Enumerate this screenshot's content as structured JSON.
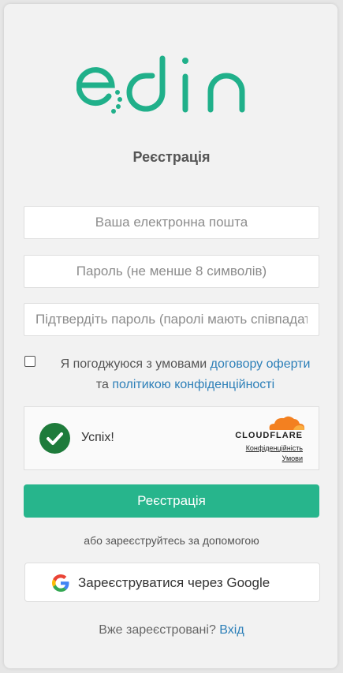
{
  "brand": {
    "logo_text": "edin",
    "logo_color": "#20b08a"
  },
  "form": {
    "title": "Реєстрація",
    "email_placeholder": "Ваша електронна пошта",
    "password_placeholder": "Пароль (не менше 8 символів)",
    "confirm_placeholder": "Підтвердіть пароль (паролі мають співпадати)",
    "agree_prefix": "Я погоджуюся з умовами",
    "agree_link_offer": "договору оферти",
    "agree_and": "та",
    "agree_link_privacy": "політикою конфіденційності",
    "agree_checked": false
  },
  "captcha": {
    "status_text": "Успіх!",
    "provider": "CLOUDFLARE",
    "privacy_link": "Конфіденційність",
    "terms_link": "Умови",
    "success_color": "#1e7b3b",
    "cloud_color": "#f38020"
  },
  "actions": {
    "register_label": "Реєстрація",
    "register_color": "#27b58c",
    "or_text": "або зареєструйтесь за допомогою",
    "google_label": "Зареєструватися через Google",
    "google_icon": "google-g-icon",
    "already_text": "Вже зареєстровані?",
    "login_link": "Вхід"
  }
}
